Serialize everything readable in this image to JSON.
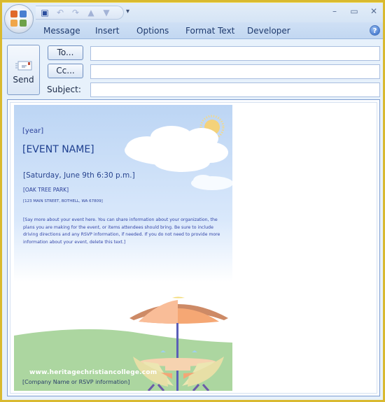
{
  "window": {
    "title": "",
    "controls": [
      "minimize",
      "maximize",
      "close"
    ]
  },
  "quick_access": {
    "icons": [
      "save-icon",
      "undo-icon",
      "redo-icon",
      "previous-item-icon",
      "next-item-icon"
    ],
    "more_label": "▾"
  },
  "ribbon": {
    "tabs": [
      {
        "label": "Message"
      },
      {
        "label": "Insert"
      },
      {
        "label": "Options"
      },
      {
        "label": "Format Text"
      },
      {
        "label": "Developer"
      }
    ],
    "help_label": "?"
  },
  "header": {
    "send_label": "Send",
    "to_label": "To...",
    "cc_label": "Cc...",
    "subject_label": "Subject:",
    "to_value": "",
    "cc_value": "",
    "subject_value": ""
  },
  "flyer": {
    "year": "[year]",
    "event_name": "[EVENT NAME]",
    "date_time": "[Saturday, June 9th 6:30 p.m.]",
    "location": "[OAK TREE PARK]",
    "address": "[123 MAIN STREET, BOTHELL, WA 67809]",
    "description": "[Say more about your event here. You can share information about your organization, the plans you are making for the event, or items attendees should bring. Be sure to include driving directions and any RSVP information, if needed. If you do not need to provide more information about your event, delete this text.]",
    "watermark": "www.heritagechristiancollege.com",
    "company": "[Company Name or RSVP information]"
  },
  "colors": {
    "frame": "#d9b92f",
    "ribbon": "#c2d7f1",
    "flyer_text": "#2a3f9a",
    "grass": "#acd6a0",
    "umbrella": "#f5a774"
  }
}
